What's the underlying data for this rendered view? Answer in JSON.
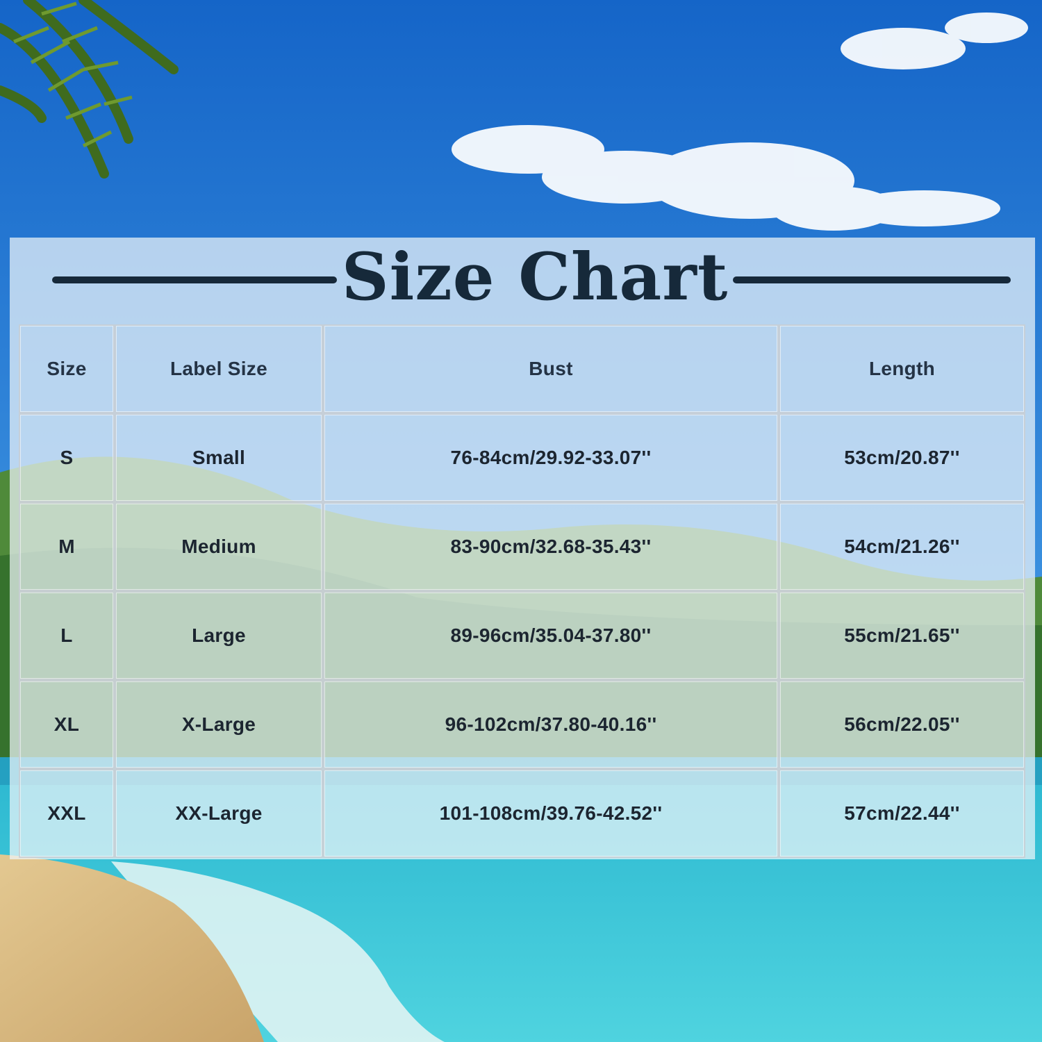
{
  "title": "Size Chart",
  "chart_data": {
    "type": "table",
    "title": "Size Chart",
    "columns": [
      "Size",
      "Label Size",
      "Bust",
      "Length"
    ],
    "rows": [
      [
        "S",
        "Small",
        "76-84cm/29.92-33.07''",
        "53cm/20.87''"
      ],
      [
        "M",
        "Medium",
        "83-90cm/32.68-35.43''",
        "54cm/21.26''"
      ],
      [
        "L",
        "Large",
        "89-96cm/35.04-37.80''",
        "55cm/21.65''"
      ],
      [
        "XL",
        "X-Large",
        "96-102cm/37.80-40.16''",
        "56cm/22.05''"
      ],
      [
        "XXL",
        "XX-Large",
        "101-108cm/39.76-42.52''",
        "57cm/22.44''"
      ]
    ]
  },
  "colors": {
    "title_text": "#16293a",
    "table_text": "#1c2530",
    "sky_top": "#1b6fd0",
    "sea": "#3fc6d8",
    "sand": "#d9bd86"
  }
}
